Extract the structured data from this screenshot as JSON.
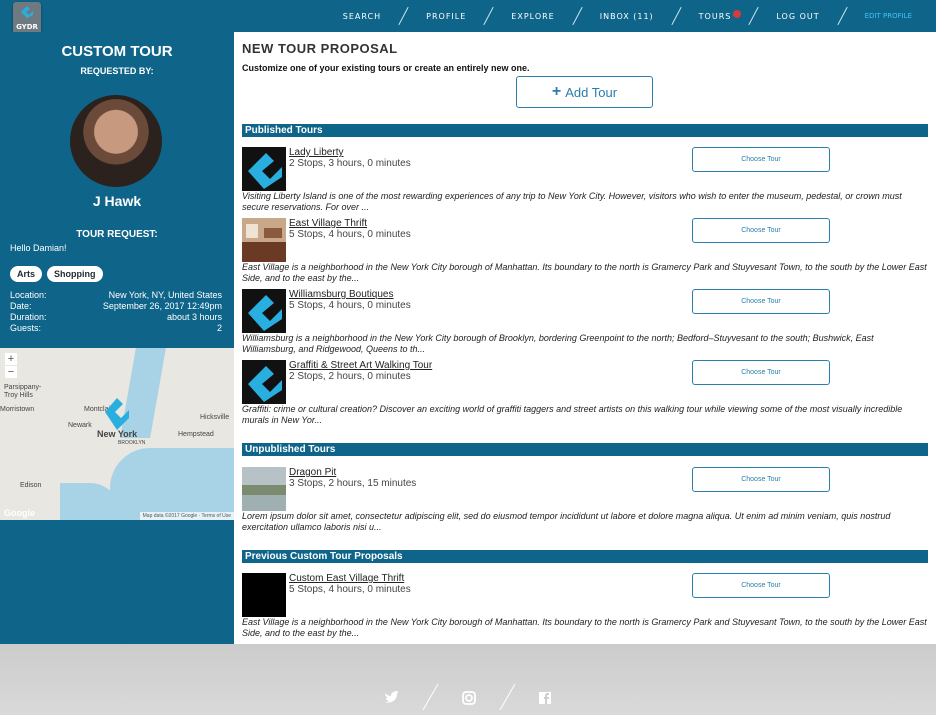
{
  "brand": {
    "logo_text": "GYDR",
    "accent": "#0e6489"
  },
  "nav": {
    "items": [
      "SEARCH",
      "PROFILE",
      "EXPLORE",
      "INBOX (11)",
      "TOURS",
      "LOG OUT"
    ],
    "edit_profile": "EDIT PROFILE"
  },
  "sidebar": {
    "title": "CUSTOM TOUR",
    "requested_by": "REQUESTED BY:",
    "name": "J Hawk",
    "tour_request_heading": "TOUR REQUEST:",
    "message": "Hello Damian!",
    "tags": [
      "Arts",
      "Shopping"
    ],
    "info": [
      {
        "label": "Location:",
        "value": "New York, NY, United States"
      },
      {
        "label": "Date:",
        "value": "September 26, 2017 12:49pm"
      },
      {
        "label": "Duration:",
        "value": "about 3 hours"
      },
      {
        "label": "Guests:",
        "value": "2"
      }
    ],
    "map": {
      "zoom_in": "+",
      "zoom_out": "−",
      "labels": [
        "Parsippany-Troy Hills",
        "Montclair",
        "Morristown",
        "Newark",
        "New York",
        "Hempstead",
        "Hicksville",
        "Edison",
        "BROOKLYN"
      ],
      "attribution": "Map data ©2017 Google · Terms of Use",
      "google": "Google"
    }
  },
  "main": {
    "title": "NEW TOUR PROPOSAL",
    "subtitle": "Customize one of your existing tours or create an entirely new one.",
    "add_tour": "Add Tour",
    "choose_label": "Choose Tour",
    "sections": {
      "published": "Published Tours",
      "unpublished": "Unpublished Tours",
      "previous": "Previous Custom Tour Proposals"
    },
    "published_tours": [
      {
        "name": "Lady Liberty",
        "meta": "2 Stops, 3 hours, 0 minutes",
        "desc": "Visiting Liberty Island is one of the most rewarding experiences of any trip to New York City. However, visitors who wish to enter the museum, pedestal, or crown must secure reservations. For over ..."
      },
      {
        "name": "East Village Thrift",
        "meta": "5 Stops, 4 hours, 0 minutes",
        "desc": "East Village is a neighborhood in the New York City borough of Manhattan. Its boundary to the north is Gramercy Park and Stuyvesant Town, to the south by the Lower East Side, and to the east by the..."
      },
      {
        "name": "Williamsburg Boutiques",
        "meta": "5 Stops, 4 hours, 0 minutes",
        "desc": "Williamsburg is a neighborhood in the New York City borough of Brooklyn, bordering Greenpoint to the north; Bedford–Stuyvesant to the south; Bushwick, East Williamsburg, and Ridgewood, Queens to th..."
      },
      {
        "name": "Graffiti & Street Art Walking Tour",
        "meta": "2 Stops, 2 hours, 0 minutes",
        "desc": "Graffiti: crime or cultural creation? Discover an exciting world of graffiti taggers and street artists on this walking tour while viewing some of the most visually incredible murals in New Yor..."
      }
    ],
    "unpublished_tours": [
      {
        "name": "Dragon Pit",
        "meta": "3 Stops, 2 hours, 15 minutes",
        "desc": "Lorem ipsum dolor sit amet, consectetur adipiscing elit, sed do eiusmod tempor incididunt ut labore et dolore magna aliqua. Ut enim ad minim veniam, quis nostrud exercitation ullamco laboris nisi u..."
      }
    ],
    "previous_proposals": [
      {
        "name": "Custom East Village Thrift",
        "meta": "5 Stops, 4 hours, 0 minutes",
        "desc": "East Village is a neighborhood in the New York City borough of Manhattan. Its boundary to the north is Gramercy Park and Stuyvesant Town, to the south by the Lower East Side, and to the east by the..."
      }
    ]
  }
}
